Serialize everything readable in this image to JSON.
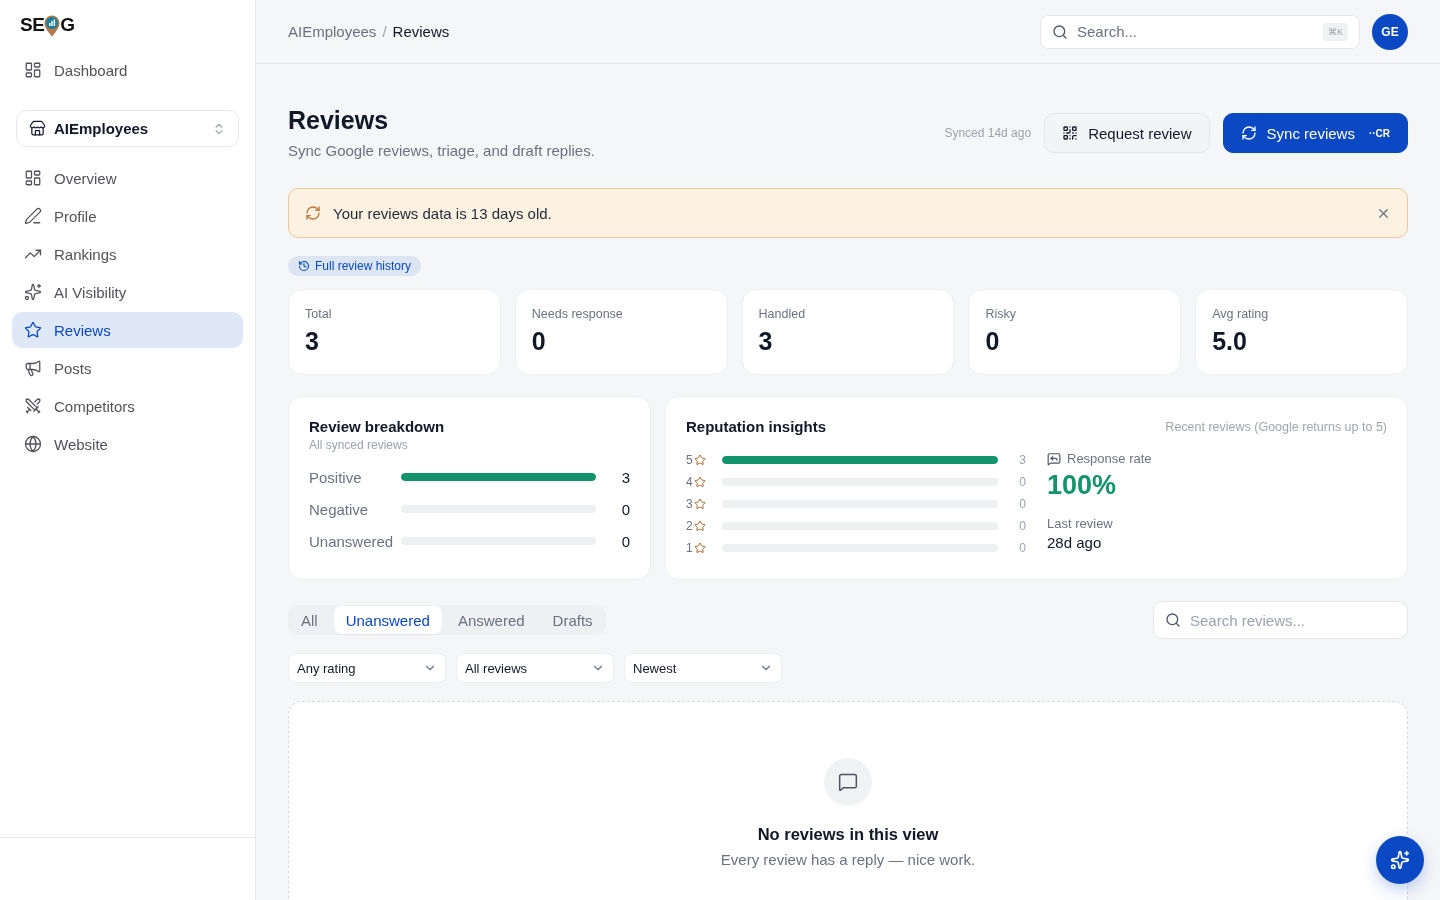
{
  "sidebar": {
    "logo": {
      "text_before_pin": "SE",
      "text_after_pin": "G"
    },
    "top_items": [
      {
        "label": "Dashboard",
        "selected": false
      }
    ],
    "workspace": {
      "name": "AIEmployees"
    },
    "items": [
      {
        "label": "Overview",
        "selected": false
      },
      {
        "label": "Profile",
        "selected": false
      },
      {
        "label": "Rankings",
        "selected": false
      },
      {
        "label": "AI Visibility",
        "selected": false
      },
      {
        "label": "Reviews",
        "selected": true
      },
      {
        "label": "Posts",
        "selected": false
      },
      {
        "label": "Competitors",
        "selected": false
      },
      {
        "label": "Website",
        "selected": false
      }
    ]
  },
  "header": {
    "breadcrumb": [
      {
        "label": "AIEmployees",
        "current": false
      },
      {
        "label": "Reviews",
        "current": true
      }
    ],
    "breadcrumb_separator": "/",
    "search": {
      "placeholder": "Search...",
      "shortcut": "⌘K"
    },
    "avatar": {
      "initials": "GE"
    }
  },
  "page": {
    "title": "Reviews",
    "subtitle": "Sync Google reviews, triage, and draft replies.",
    "sync_status": "Synced 14d ago",
    "actions": [
      {
        "kind": "secondary",
        "label": "Request review"
      },
      {
        "kind": "primary",
        "label": "Sync reviews",
        "shortcut": "··CR"
      }
    ]
  },
  "alert": {
    "message": "Your reviews data is 13 days old.",
    "dismissible": true
  },
  "history_chip": {
    "label": "Full review history"
  },
  "stats": [
    {
      "label": "Total",
      "value": "3"
    },
    {
      "label": "Needs response",
      "value": "0"
    },
    {
      "label": "Handled",
      "value": "3"
    },
    {
      "label": "Risky",
      "value": "0"
    },
    {
      "label": "Avg rating",
      "value": "5.0"
    }
  ],
  "review_breakdown": {
    "title": "Review breakdown",
    "subtitle": "All synced reviews",
    "rows": [
      {
        "label": "Positive",
        "count": "3",
        "level": 1
      },
      {
        "label": "Negative",
        "count": "0",
        "level": 0
      },
      {
        "label": "Unanswered",
        "count": "0",
        "level": 0
      }
    ]
  },
  "reputation": {
    "title": "Reputation insights",
    "caption": "Recent reviews (Google returns up to 5)",
    "distribution": [
      {
        "rating": "5",
        "count": "3",
        "level": 1
      },
      {
        "rating": "4",
        "count": "0",
        "level": 0
      },
      {
        "rating": "3",
        "count": "0",
        "level": 0
      },
      {
        "rating": "2",
        "count": "0",
        "level": 0
      },
      {
        "rating": "1",
        "count": "0",
        "level": 0
      }
    ],
    "response_rate": {
      "label": "Response rate",
      "value": "100%"
    },
    "last_review": {
      "label": "Last review",
      "value": "28d ago"
    }
  },
  "review_tabs": {
    "tabs": [
      {
        "label": "All",
        "selected": false
      },
      {
        "label": "Unanswered",
        "selected": true
      },
      {
        "label": "Answered",
        "selected": false
      },
      {
        "label": "Drafts",
        "selected": false
      }
    ],
    "search": {
      "placeholder": "Search reviews..."
    }
  },
  "filters": [
    {
      "value": "Any rating"
    },
    {
      "value": "All reviews"
    },
    {
      "value": "Newest"
    }
  ],
  "empty_state": {
    "title": "No reviews in this view",
    "message": "Every review has a reply — nice work."
  }
}
